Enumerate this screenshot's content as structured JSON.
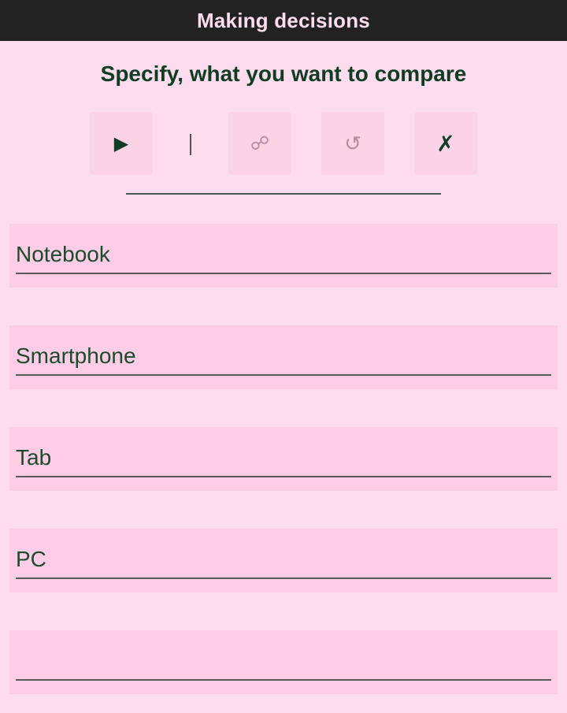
{
  "app": {
    "title": "Making decisions"
  },
  "main": {
    "heading": "Specify, what you want to compare"
  },
  "toolbar": {
    "play_icon": "▶",
    "link_icon": "☍",
    "reset_icon": "↺",
    "clear_icon": "✗"
  },
  "items": [
    {
      "value": "Notebook",
      "placeholder": ""
    },
    {
      "value": "Smartphone",
      "placeholder": ""
    },
    {
      "value": "Tab",
      "placeholder": ""
    },
    {
      "value": "PC",
      "placeholder": ""
    },
    {
      "value": "",
      "placeholder": ""
    }
  ],
  "colors": {
    "background": "#fcdced",
    "titlebar": "#222222",
    "title_text": "#fcdced",
    "heading_text": "#0f3d24",
    "field_background": "#fdcde5",
    "input_text": "#1c4a2e",
    "disabled_icon": "#b58a9a"
  }
}
